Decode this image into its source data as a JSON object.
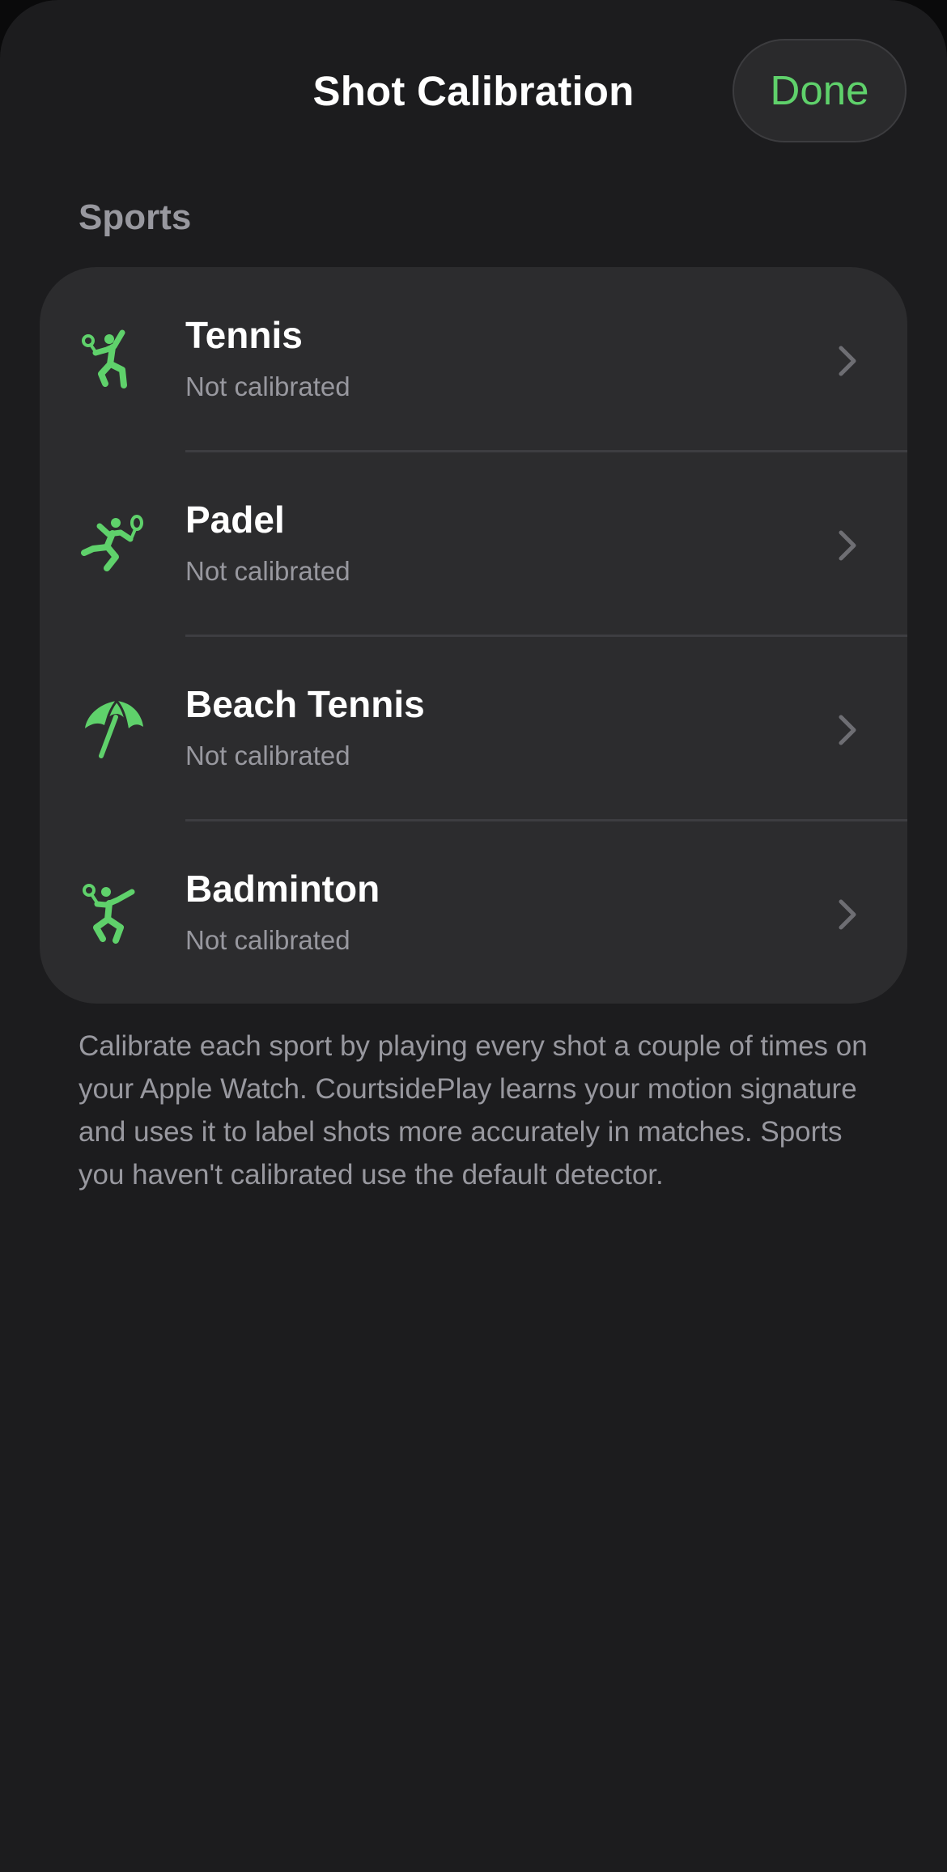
{
  "header": {
    "title": "Shot Calibration",
    "done_label": "Done"
  },
  "section": {
    "title": "Sports"
  },
  "sports": [
    {
      "name": "Tennis",
      "status": "Not calibrated",
      "icon": "tennis-player-icon"
    },
    {
      "name": "Padel",
      "status": "Not calibrated",
      "icon": "padel-player-icon"
    },
    {
      "name": "Beach Tennis",
      "status": "Not calibrated",
      "icon": "beach-umbrella-icon"
    },
    {
      "name": "Badminton",
      "status": "Not calibrated",
      "icon": "badminton-player-icon"
    }
  ],
  "footer": {
    "text": "Calibrate each sport by playing every shot a couple of times on your Apple Watch. CourtsidePlay learns your motion signature and uses it to label shots more accurately in matches. Sports you haven't calibrated use the default detector."
  },
  "colors": {
    "accent": "#5fd16b",
    "background": "#1c1c1e",
    "card": "#2c2c2e",
    "secondary_text": "#98989f"
  }
}
